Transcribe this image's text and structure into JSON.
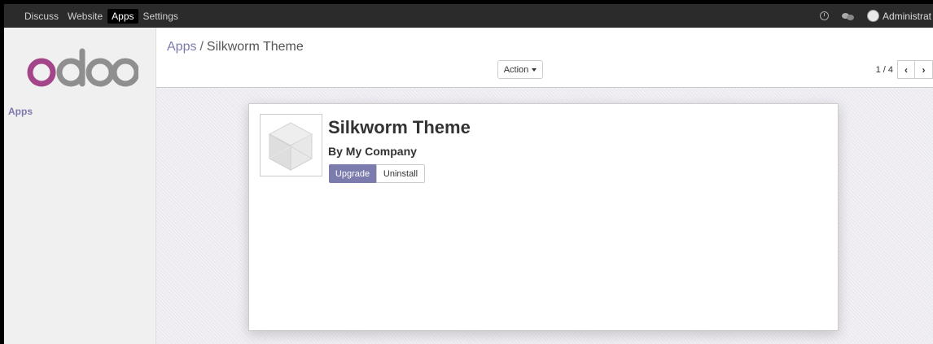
{
  "topbar": {
    "menu": [
      "Discuss",
      "Website",
      "Apps",
      "Settings"
    ],
    "active_menu": "Apps",
    "user_name": "Administrat"
  },
  "sidebar": {
    "logo_text": "odoo",
    "items": [
      {
        "label": "Apps"
      }
    ]
  },
  "control": {
    "breadcrumb_parent": "Apps",
    "breadcrumb_separator": "/",
    "breadcrumb_current": "Silkworm Theme",
    "action_label": "Action",
    "pager_value": "1 / 4",
    "pager_prev": "‹",
    "pager_next": "›"
  },
  "app": {
    "title": "Silkworm Theme",
    "author": "By My Company",
    "upgrade_label": "Upgrade",
    "uninstall_label": "Uninstall",
    "icon": "cube-icon"
  },
  "colors": {
    "topbar_bg": "#2b2b2b",
    "accent": "#7c7bad",
    "logo_o": "#a24689",
    "logo_doo": "#8f8f8f"
  },
  "icons": [
    "clock-icon",
    "chat-icon",
    "avatar",
    "cube-icon",
    "caret-down-icon",
    "chevron-left-icon",
    "chevron-right-icon"
  ]
}
